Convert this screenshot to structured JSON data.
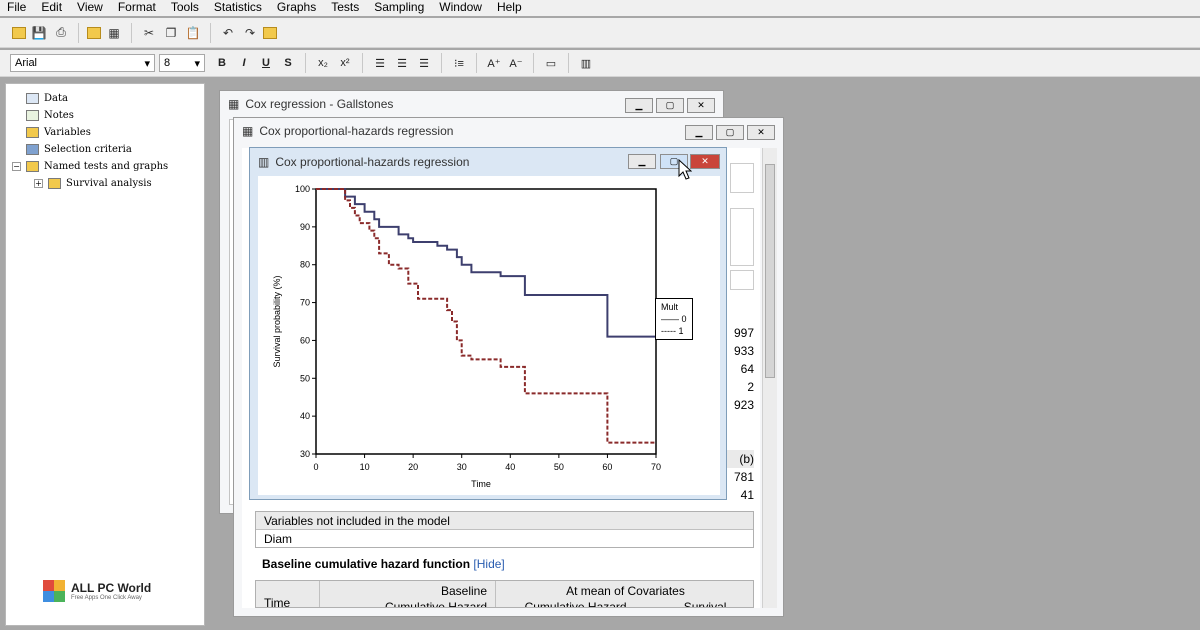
{
  "menu": [
    "File",
    "Edit",
    "View",
    "Format",
    "Tools",
    "Statistics",
    "Graphs",
    "Tests",
    "Sampling",
    "Window",
    "Help"
  ],
  "font": {
    "name": "Arial",
    "size": "8"
  },
  "format_buttons": {
    "bold": "B",
    "italic": "I",
    "underline": "U",
    "strike": "S"
  },
  "tree": [
    {
      "label": "Data"
    },
    {
      "label": "Notes"
    },
    {
      "label": "Variables"
    },
    {
      "label": "Selection criteria"
    },
    {
      "label": "Named tests and graphs"
    },
    {
      "label": "Survival analysis"
    }
  ],
  "win1": {
    "title": "Cox regression - Gallstones"
  },
  "win2": {
    "title": "Cox proportional-hazards regression",
    "right_values": [
      "997",
      "933",
      "64",
      "2",
      "923"
    ],
    "right_values2": [
      "(b)",
      "781",
      "41"
    ],
    "notin_header": "Variables not included in the model",
    "notin_value": "Diam",
    "baseline_title": "Baseline cumulative hazard function",
    "hide_link": "[Hide]",
    "table_headers": {
      "time": "Time",
      "baseline": "Baseline",
      "cum_hazard": "Cumulative Hazard",
      "at_mean": "At mean of Covariates",
      "cum_hazard2": "Cumulative Hazard",
      "survival": "Survival"
    }
  },
  "win3": {
    "title": "Cox proportional-hazards regression"
  },
  "watermark": {
    "title": "ALL PC World",
    "subtitle": "Free Apps One Click Away"
  },
  "chart_data": {
    "type": "line",
    "xlabel": "Time",
    "ylabel": "Survival probability (%)",
    "xlim": [
      0,
      70
    ],
    "ylim": [
      30,
      100
    ],
    "xticks": [
      0,
      10,
      20,
      30,
      40,
      50,
      60,
      70
    ],
    "yticks": [
      30,
      40,
      50,
      60,
      70,
      80,
      90,
      100
    ],
    "legend": {
      "title": "Mult",
      "position": "right",
      "items": [
        "0",
        "1"
      ]
    },
    "series": [
      {
        "name": "0",
        "style": "solid",
        "color": "#3d3f6e",
        "points": [
          [
            0,
            100
          ],
          [
            6,
            100
          ],
          [
            6,
            98
          ],
          [
            8,
            98
          ],
          [
            8,
            96
          ],
          [
            10,
            96
          ],
          [
            10,
            94
          ],
          [
            12,
            94
          ],
          [
            12,
            92
          ],
          [
            13,
            92
          ],
          [
            13,
            90
          ],
          [
            17,
            90
          ],
          [
            17,
            88
          ],
          [
            19,
            88
          ],
          [
            19,
            87
          ],
          [
            20,
            87
          ],
          [
            20,
            86
          ],
          [
            25,
            86
          ],
          [
            25,
            85
          ],
          [
            27,
            85
          ],
          [
            27,
            84
          ],
          [
            29,
            84
          ],
          [
            29,
            82
          ],
          [
            30,
            82
          ],
          [
            30,
            80
          ],
          [
            32,
            80
          ],
          [
            32,
            78
          ],
          [
            38,
            78
          ],
          [
            38,
            77
          ],
          [
            43,
            77
          ],
          [
            43,
            72
          ],
          [
            60,
            72
          ],
          [
            60,
            61
          ],
          [
            70,
            61
          ]
        ]
      },
      {
        "name": "1",
        "style": "dashed",
        "color": "#8a2a2a",
        "points": [
          [
            0,
            100
          ],
          [
            6,
            100
          ],
          [
            6,
            97
          ],
          [
            7,
            97
          ],
          [
            7,
            95
          ],
          [
            8,
            95
          ],
          [
            8,
            93
          ],
          [
            9,
            93
          ],
          [
            9,
            91
          ],
          [
            11,
            91
          ],
          [
            11,
            89
          ],
          [
            12,
            89
          ],
          [
            12,
            87
          ],
          [
            13,
            87
          ],
          [
            13,
            83
          ],
          [
            15,
            83
          ],
          [
            15,
            80
          ],
          [
            17,
            80
          ],
          [
            17,
            79
          ],
          [
            19,
            79
          ],
          [
            19,
            75
          ],
          [
            21,
            75
          ],
          [
            21,
            71
          ],
          [
            27,
            71
          ],
          [
            27,
            68
          ],
          [
            28,
            68
          ],
          [
            28,
            65
          ],
          [
            29,
            65
          ],
          [
            29,
            60
          ],
          [
            30,
            60
          ],
          [
            30,
            56
          ],
          [
            32,
            56
          ],
          [
            32,
            55
          ],
          [
            38,
            55
          ],
          [
            38,
            53
          ],
          [
            43,
            53
          ],
          [
            43,
            46
          ],
          [
            60,
            46
          ],
          [
            60,
            33
          ],
          [
            70,
            33
          ]
        ]
      }
    ]
  }
}
